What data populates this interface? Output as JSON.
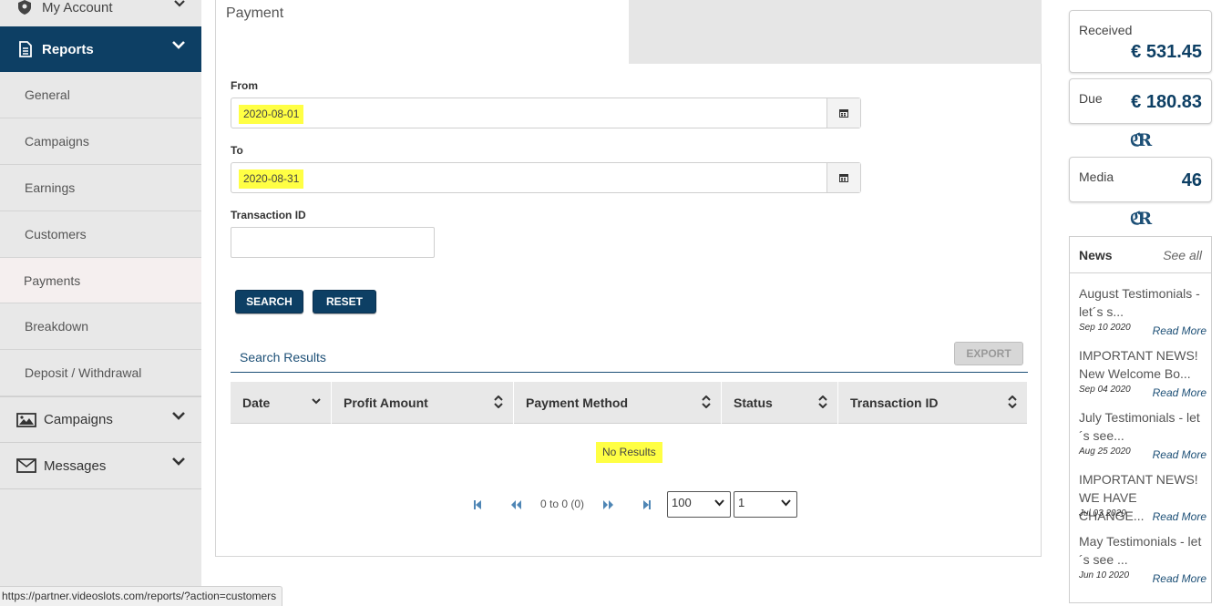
{
  "sidebar": {
    "my_account": "My Account",
    "reports": "Reports",
    "sub_items": [
      "General",
      "Campaigns",
      "Earnings",
      "Customers",
      "Payments",
      "Breakdown",
      "Deposit / Withdrawal"
    ],
    "active_sub_item": "Payments",
    "campaigns": "Campaigns",
    "messages": "Messages"
  },
  "main": {
    "tab_title": "Payment",
    "from_label": "From",
    "from_value": "2020-08-01",
    "to_label": "To",
    "to_value": "2020-08-31",
    "transaction_id_label": "Transaction ID",
    "transaction_id_value": "",
    "search_button": "SEARCH",
    "reset_button": "RESET",
    "results_title": "Search Results",
    "export_button": "EXPORT",
    "columns": [
      "Date",
      "Profit Amount",
      "Payment Method",
      "Status",
      "Transaction ID"
    ],
    "no_results": "No Results",
    "pager_text": "0 to 0 (0)",
    "page_size": "100",
    "page_number": "1"
  },
  "stats": {
    "received_label": "Received",
    "received_amount": "€ 531.45",
    "due_label": "Due",
    "due_amount": "€ 180.83",
    "media_label": "Media",
    "media_count": "46"
  },
  "news": {
    "title": "News",
    "see_all": "See all",
    "items": [
      {
        "title": "August Testimonials - let´s s...",
        "date": "Sep 10 2020",
        "more": "Read More"
      },
      {
        "title": "IMPORTANT NEWS! New Welcome Bo...",
        "date": "Sep 04 2020",
        "more": "Read More"
      },
      {
        "title": "July Testimonials - let´s see...",
        "date": "Aug 25 2020",
        "more": "Read More"
      },
      {
        "title": "IMPORTANT NEWS! WE HAVE CHANGE...",
        "date": "Jul 03 2020",
        "more": "Read More"
      },
      {
        "title": "May Testimonials - let´s see ...",
        "date": "Jun 10 2020",
        "more": "Read More"
      }
    ]
  },
  "status_bar": {
    "url": "https://partner.videoslots.com/reports/?action=customers"
  },
  "colors": {
    "brand": "#0d3f64",
    "highlight": "#ffff44"
  }
}
